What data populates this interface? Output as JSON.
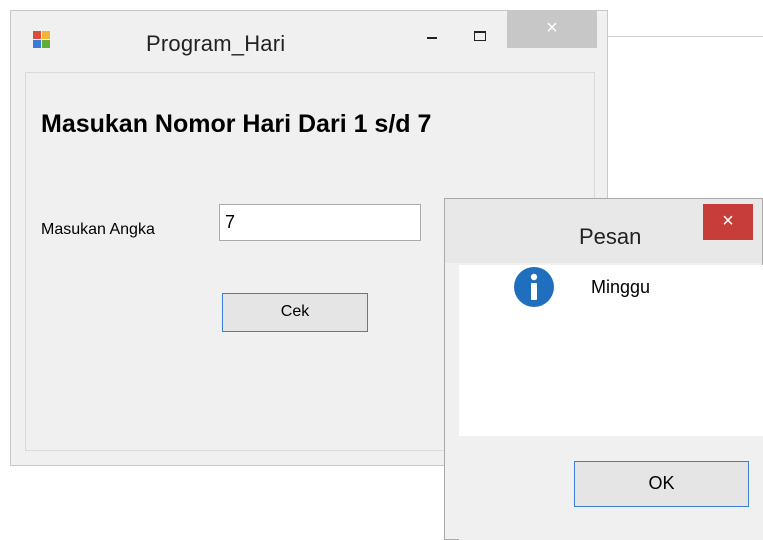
{
  "main_window": {
    "title": "Program_Hari",
    "close_glyph": "×",
    "heading": "Masukan Nomor Hari Dari 1 s/d 7",
    "input_label": "Masukan Angka",
    "input_value": "7",
    "button_label": "Cek"
  },
  "message_box": {
    "title": "Pesan",
    "close_glyph": "×",
    "message": "Minggu",
    "icon": "info-icon",
    "ok_label": "OK"
  },
  "colors": {
    "window_bg": "#f0f0f0",
    "close_red": "#c63d39",
    "button_border": "#3c7fd6",
    "info_blue": "#1f6fbe"
  }
}
